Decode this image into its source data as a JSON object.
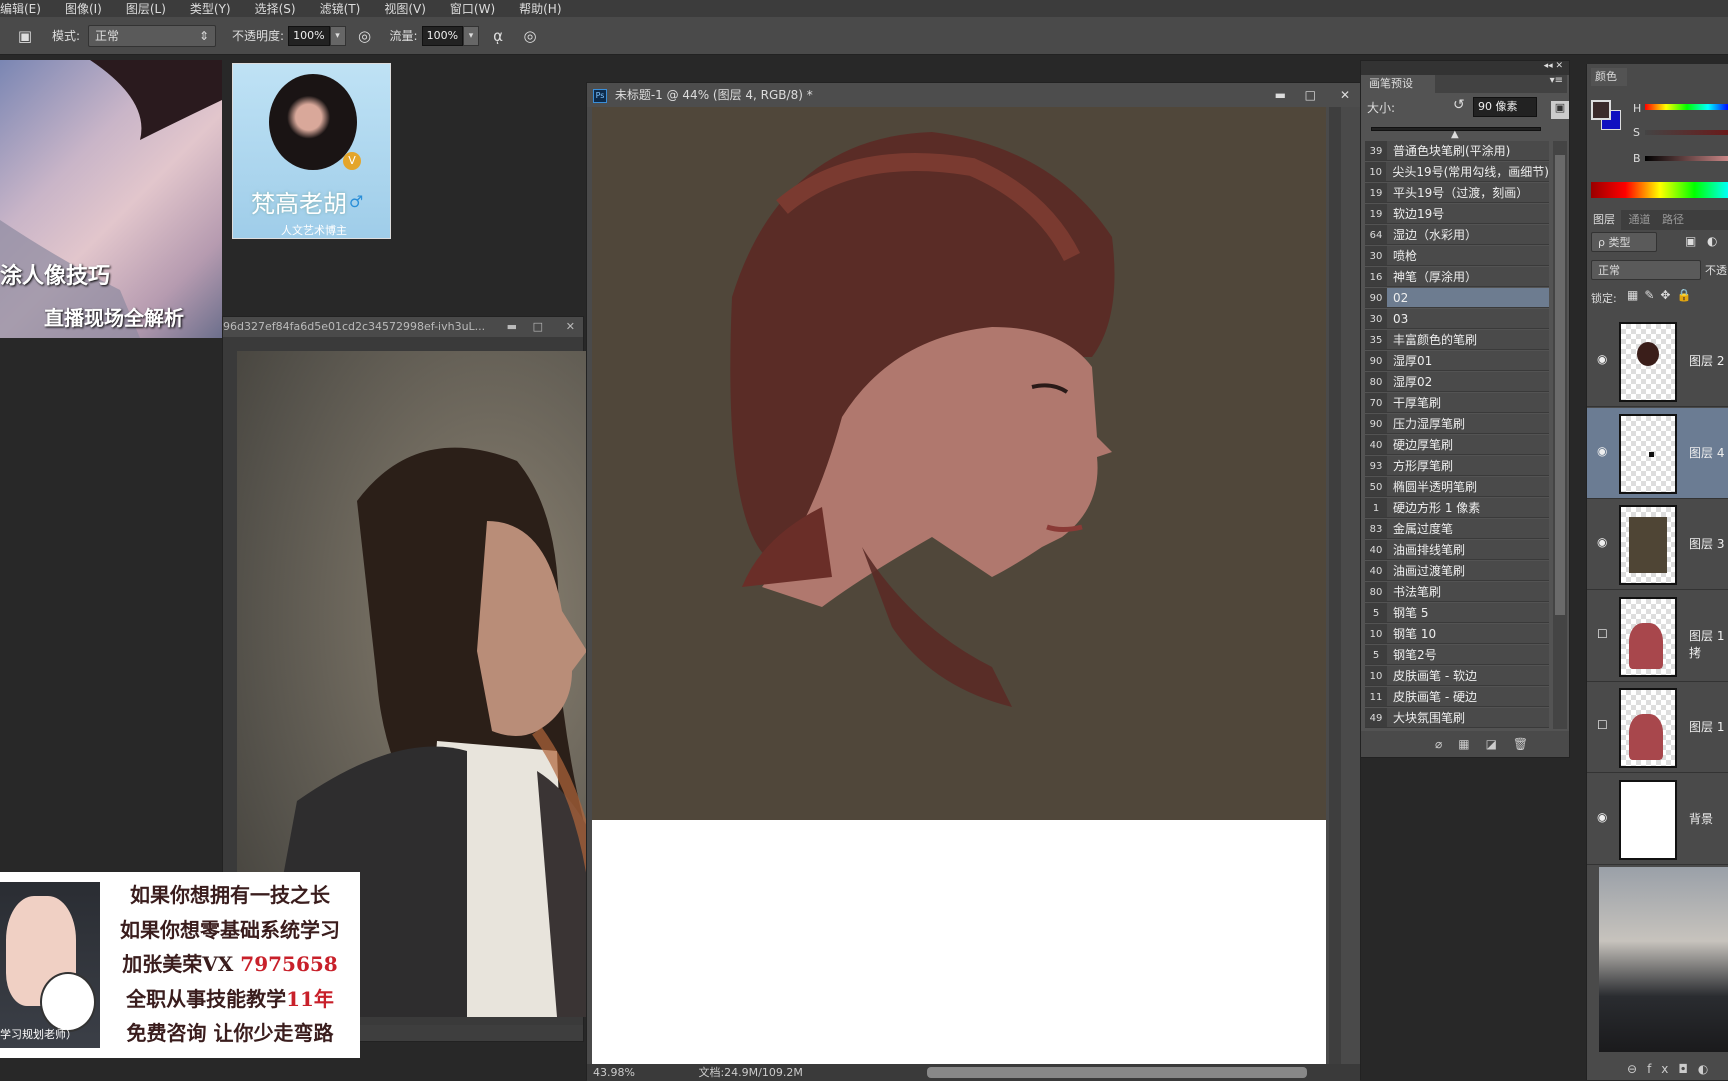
{
  "menu": [
    "编辑(E)",
    "图像(I)",
    "图层(L)",
    "类型(Y)",
    "选择(S)",
    "滤镜(T)",
    "视图(V)",
    "窗口(W)",
    "帮助(H)"
  ],
  "options": {
    "mode_label": "模式:",
    "mode_value": "正常",
    "opacity_label": "不透明度:",
    "opacity_value": "100%",
    "flow_label": "流量:",
    "flow_value": "100%"
  },
  "promo": {
    "line1": "涂人像技巧",
    "line2": "直播现场全解析"
  },
  "profile": {
    "name": "梵高老胡",
    "subtitle": "人文艺术博主",
    "badge": "V",
    "gender": "♂"
  },
  "reference_window": {
    "title": "96d327ef84fa6d5e01cd2c34572998ef-ivh3uL..."
  },
  "ad": {
    "lines": [
      "如果你想拥有一技之长",
      "如果你想零基础系统学习"
    ],
    "line3_prefix": "加张美荣VX ",
    "line3_number": "7975658",
    "line4_prefix": "全职从事技能教学",
    "line4_highlight": "11年",
    "line5": "免费咨询 让你少走弯路",
    "caption": "学习规划老师）"
  },
  "document": {
    "title": "未标题-1 @ 44% (图层 4, RGB/8) *",
    "zoom": "43.98%",
    "doc_info": "文档:24.9M/109.2M",
    "canvas_color": "#50473a"
  },
  "brush_panel": {
    "tab": "画笔预设",
    "size_label": "大小:",
    "size_value": "90 像素",
    "slider_fraction": 0.5,
    "selected_index": 7,
    "brushes": [
      {
        "size": "39",
        "name": "普通色块笔刷(平涂用)"
      },
      {
        "size": "10",
        "name": "尖头19号(常用勾线，画细节)"
      },
      {
        "size": "19",
        "name": "平头19号（过渡，刻画）"
      },
      {
        "size": "19",
        "name": "软边19号"
      },
      {
        "size": "64",
        "name": "湿边（水彩用）"
      },
      {
        "size": "30",
        "name": "喷枪"
      },
      {
        "size": "16",
        "name": "神笔（厚涂用）"
      },
      {
        "size": "90",
        "name": "02"
      },
      {
        "size": "30",
        "name": "03"
      },
      {
        "size": "35",
        "name": "丰富颜色的笔刷"
      },
      {
        "size": "90",
        "name": "湿厚01"
      },
      {
        "size": "80",
        "name": "湿厚02"
      },
      {
        "size": "70",
        "name": "干厚笔刷"
      },
      {
        "size": "90",
        "name": "压力湿厚笔刷"
      },
      {
        "size": "40",
        "name": "硬边厚笔刷"
      },
      {
        "size": "93",
        "name": "方形厚笔刷"
      },
      {
        "size": "50",
        "name": "椭圆半透明笔刷"
      },
      {
        "size": "1",
        "name": "硬边方形 1 像素"
      },
      {
        "size": "83",
        "name": "金属过度笔"
      },
      {
        "size": "40",
        "name": "油画排线笔刷"
      },
      {
        "size": "40",
        "name": "油画过渡笔刷"
      },
      {
        "size": "80",
        "name": "书法笔刷"
      },
      {
        "size": "5",
        "name": "钢笔 5"
      },
      {
        "size": "10",
        "name": "钢笔 10"
      },
      {
        "size": "5",
        "name": "钢笔2号"
      },
      {
        "size": "10",
        "name": "皮肤画笔 - 软边"
      },
      {
        "size": "11",
        "name": "皮肤画笔 - 硬边"
      },
      {
        "size": "49",
        "name": "大块氛围笔刷"
      }
    ]
  },
  "color_panel": {
    "tab": "颜色",
    "h": "H",
    "s": "S",
    "b": "B",
    "foreground": "#3b2a2a",
    "background": "#1010c0"
  },
  "layers_panel": {
    "tabs": [
      "图层",
      "通道",
      "路径"
    ],
    "filter": "ρ 类型",
    "blend": "正常",
    "opacity_label": "不透",
    "lock_label": "锁定:",
    "layers": [
      {
        "name": "图层 2",
        "visible": true
      },
      {
        "name": "图层 4",
        "visible": true,
        "selected": true
      },
      {
        "name": "图层 3",
        "visible": true
      },
      {
        "name": "图层 1 拷",
        "visible": false
      },
      {
        "name": "图层 1",
        "visible": false
      },
      {
        "name": "背景",
        "visible": true
      }
    ]
  }
}
